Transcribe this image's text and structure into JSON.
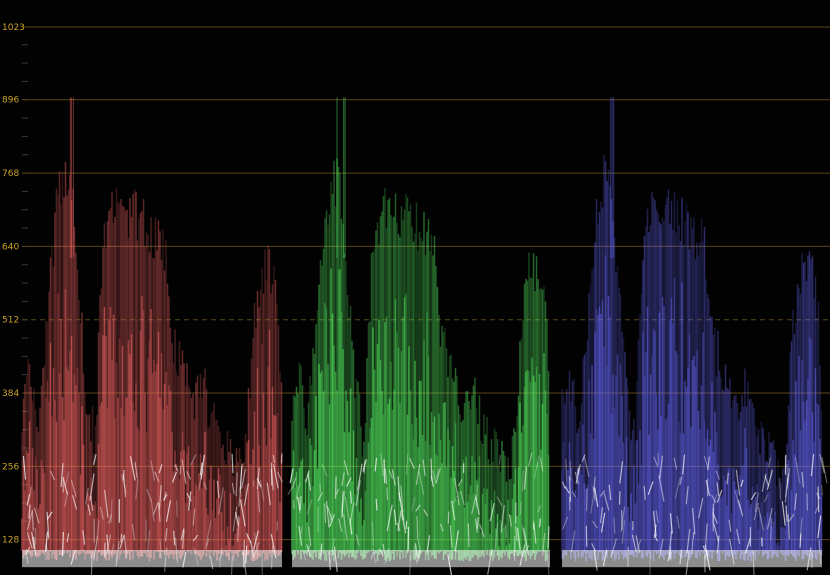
{
  "scope": {
    "type": "rgb-parade",
    "scale": {
      "min": 0,
      "max": 1023,
      "labeled_ticks": [
        "1023",
        "896",
        "768",
        "640",
        "512",
        "384",
        "256",
        "128"
      ],
      "dashed_tick": "512"
    },
    "channels": [
      "red",
      "green",
      "blue"
    ],
    "colors": {
      "red": "#ff6a6a",
      "green": "#5dff6a",
      "blue": "#6a6aff",
      "label": "#c9a227",
      "gridline": "#5a4418",
      "background": "#020202"
    }
  }
}
